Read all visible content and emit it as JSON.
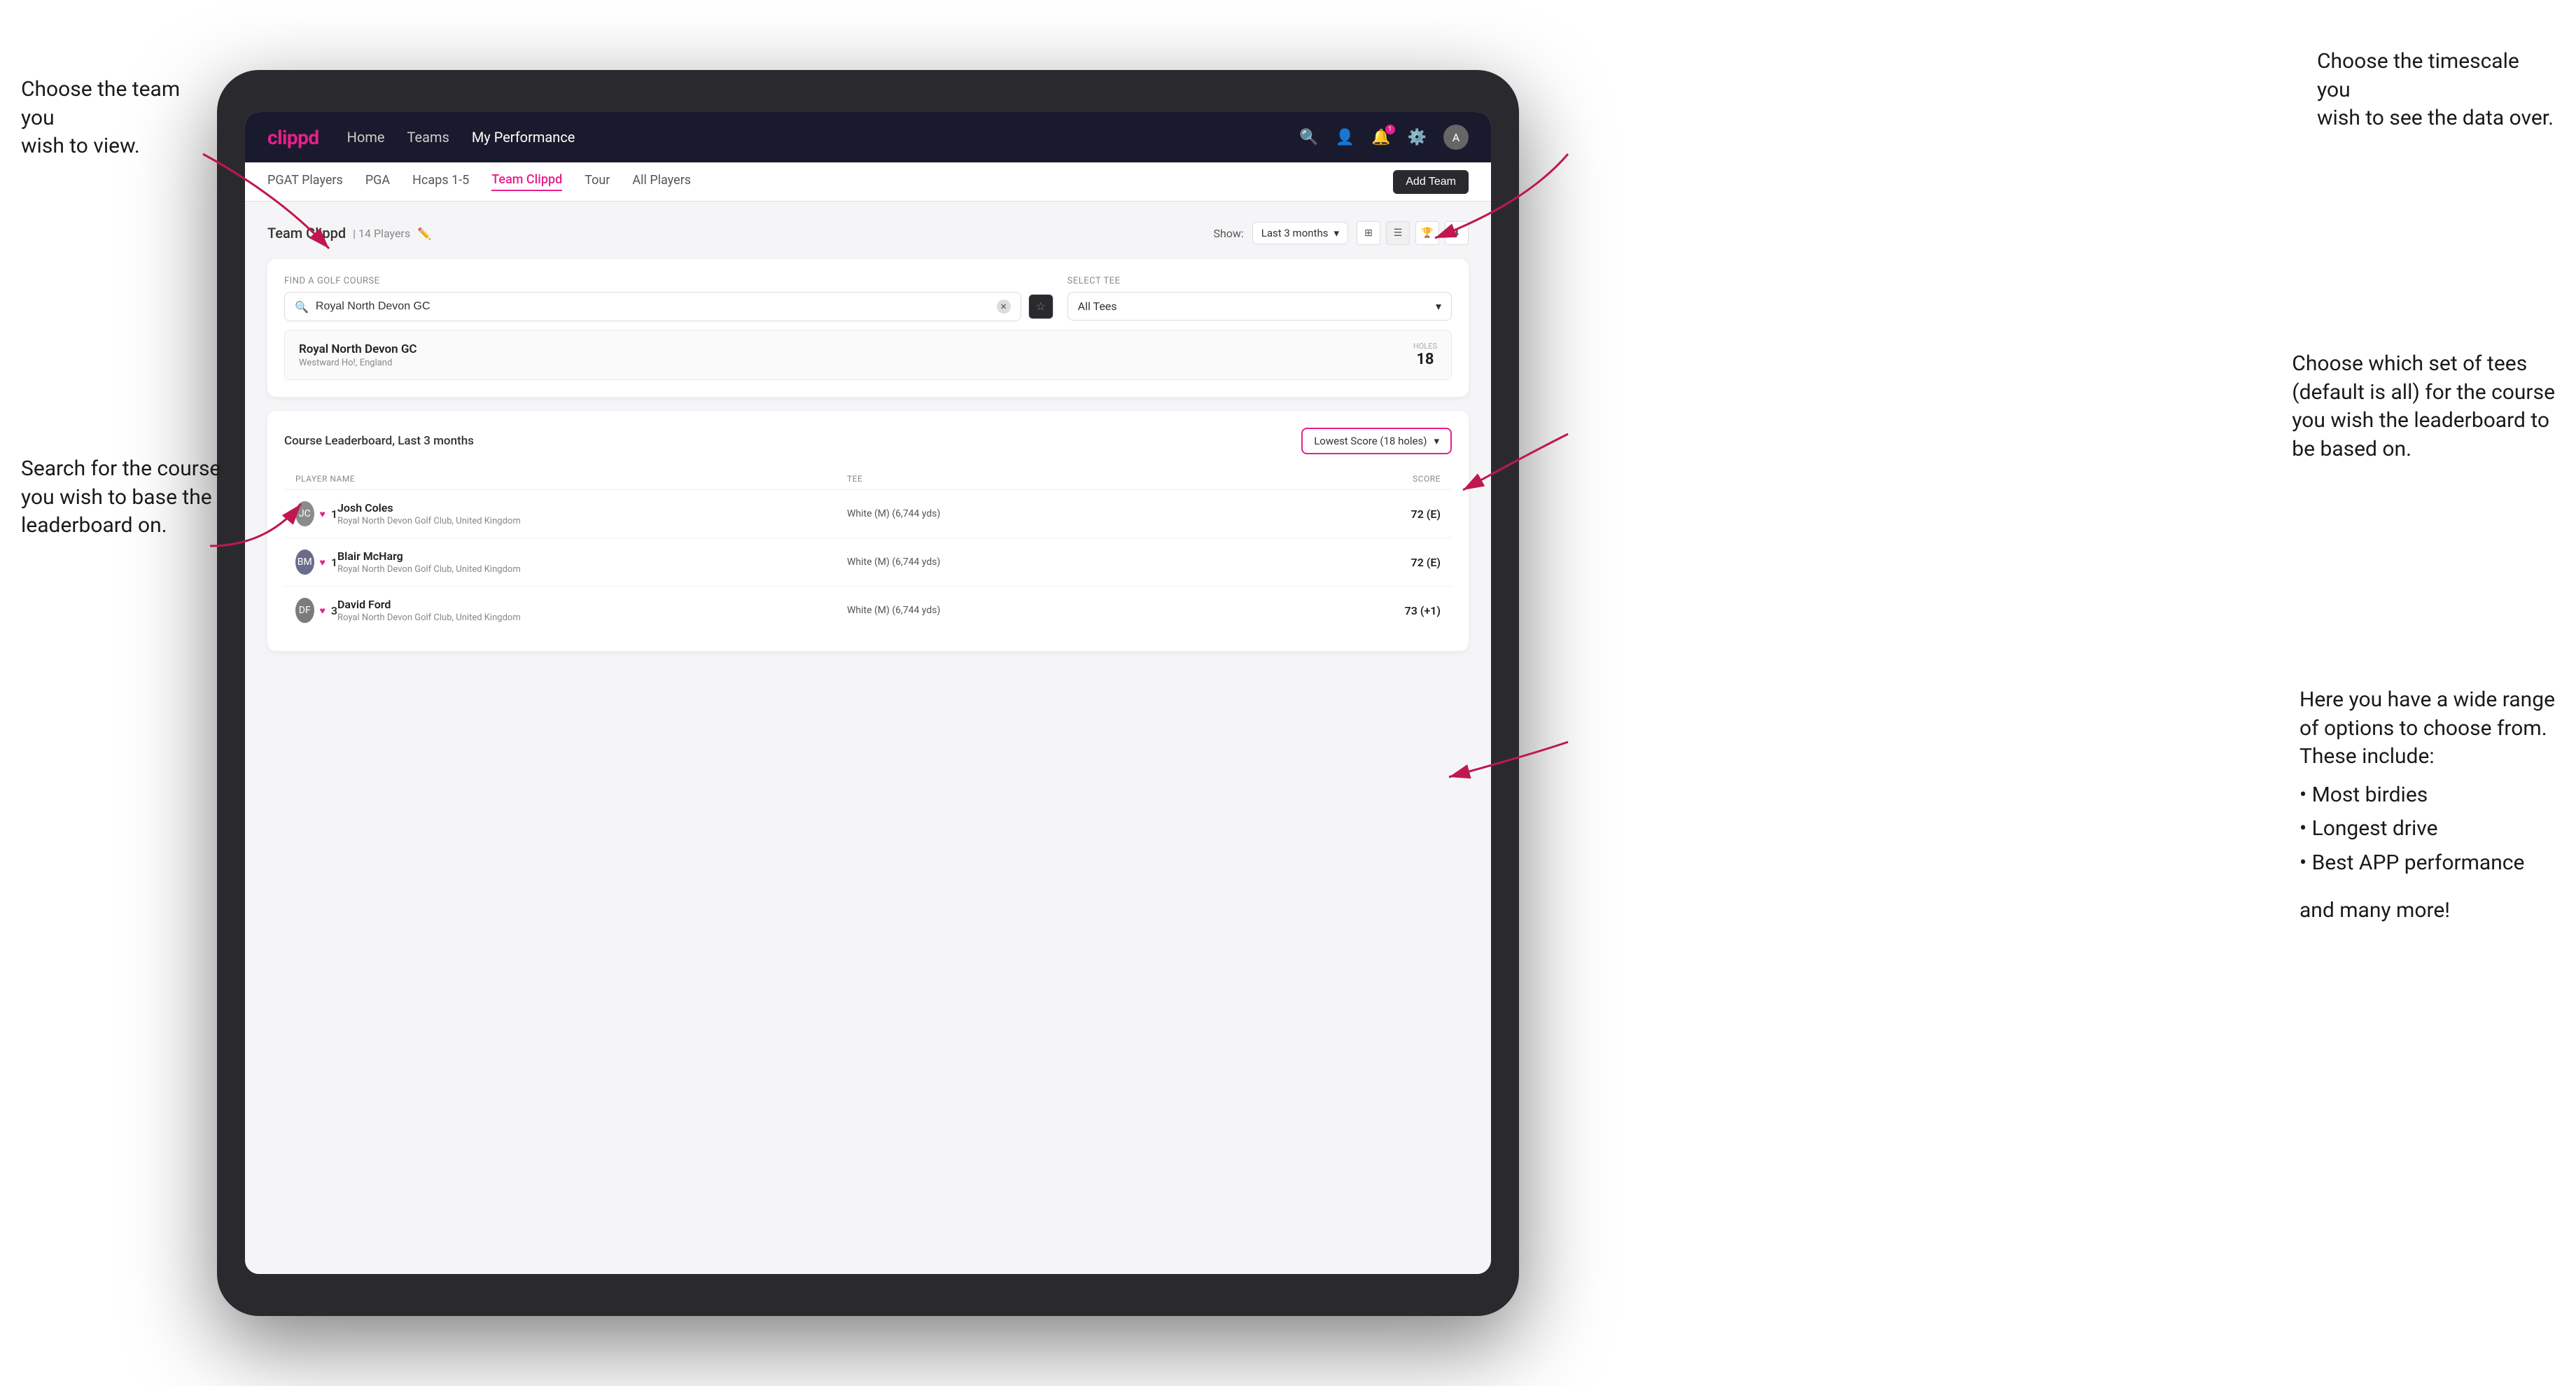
{
  "annotations": {
    "top_left_title": "Choose the team you",
    "top_left_line2": "wish to view.",
    "mid_left_title": "Search for the course",
    "mid_left_line2": "you wish to base the",
    "mid_left_line3": "leaderboard on.",
    "top_right_title": "Choose the timescale you",
    "top_right_line2": "wish to see the data over.",
    "mid_right_title": "Choose which set of tees",
    "mid_right_line2": "(default is all) for the course",
    "mid_right_line3": "you wish the leaderboard to",
    "mid_right_line4": "be based on.",
    "bottom_right_title": "Here you have a wide range",
    "bottom_right_line2": "of options to choose from.",
    "bottom_right_line3": "These include:",
    "bullet1": "Most birdies",
    "bullet2": "Longest drive",
    "bullet3": "Best APP performance",
    "and_more": "and many more!"
  },
  "nav": {
    "logo": "clippd",
    "links": [
      "Home",
      "Teams",
      "My Performance"
    ],
    "active_link": "My Performance"
  },
  "sub_nav": {
    "items": [
      "PGAT Players",
      "PGA",
      "Hcaps 1-5",
      "Team Clippd",
      "Tour",
      "All Players"
    ],
    "active_item": "Team Clippd",
    "add_team_label": "Add Team"
  },
  "team_header": {
    "title": "Team Clippd",
    "count": "14 Players",
    "show_label": "Show:",
    "time_filter": "Last 3 months"
  },
  "filter": {
    "find_label": "Find a Golf Course",
    "search_placeholder": "Royal North Devon GC",
    "select_tee_label": "Select Tee",
    "tee_value": "All Tees"
  },
  "course_result": {
    "name": "Royal North Devon GC",
    "location": "Westward Ho!, England",
    "holes_label": "Holes",
    "holes_value": "18"
  },
  "leaderboard": {
    "title": "Course Leaderboard, Last 3 months",
    "score_option": "Lowest Score (18 holes)",
    "columns": [
      "PLAYER NAME",
      "TEE",
      "SCORE"
    ],
    "rows": [
      {
        "rank": "1",
        "name": "Josh Coles",
        "club": "Royal North Devon Golf Club, United Kingdom",
        "tee": "White (M) (6,744 yds)",
        "score": "72 (E)",
        "avatar_color": "#8B8B8B"
      },
      {
        "rank": "1",
        "name": "Blair McHarg",
        "club": "Royal North Devon Golf Club, United Kingdom",
        "tee": "White (M) (6,744 yds)",
        "score": "72 (E)",
        "avatar_color": "#6B6B8B"
      },
      {
        "rank": "3",
        "name": "David Ford",
        "club": "Royal North Devon Golf Club, United Kingdom",
        "tee": "White (M) (6,744 yds)",
        "score": "73 (+1)",
        "avatar_color": "#7B7B7B"
      }
    ]
  }
}
